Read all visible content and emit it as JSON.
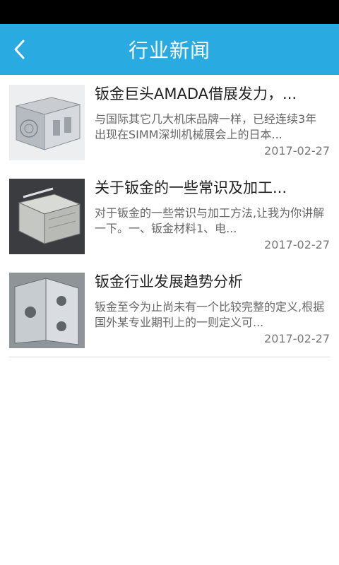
{
  "header": {
    "title": "行业新闻",
    "back_icon": "chevron-left-icon",
    "color": "#29abe2"
  },
  "news": [
    {
      "title": "钣金巨头AMADA借展发力，...",
      "summary": "与国际其它几大机床品牌一样，已经连续3年出现在SIMM深圳机械展会上的日本...",
      "date": "2017-02-27"
    },
    {
      "title": "关于钣金的一些常识及加工...",
      "summary": "对于钣金的一些常识与加工方法,让我为你讲解一下。一、钣金材料1、电...",
      "date": "2017-02-27"
    },
    {
      "title": "钣金行业发展趋势分析",
      "summary": "钣金至今为止尚未有一个比较完整的定义,根据国外某专业期刊上的一则定义可...",
      "date": "2017-02-27"
    }
  ]
}
